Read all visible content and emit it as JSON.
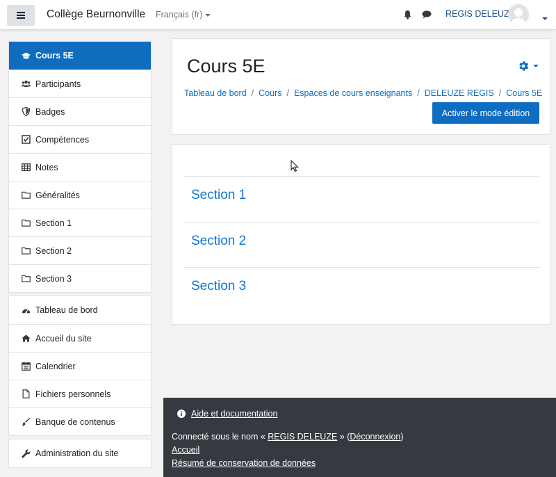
{
  "navbar": {
    "site_name": "Collège Beurnonville",
    "language": "Français (fr)",
    "user_name": "REGIS DELEUZE"
  },
  "drawer": {
    "course_items": [
      {
        "label": "Cours 5E",
        "icon": "graduation-cap-icon",
        "active": true
      },
      {
        "label": "Participants",
        "icon": "users-icon"
      },
      {
        "label": "Badges",
        "icon": "shield-icon"
      },
      {
        "label": "Compétences",
        "icon": "checkbox-icon"
      },
      {
        "label": "Notes",
        "icon": "table-icon"
      },
      {
        "label": "Généralités",
        "icon": "folder-icon"
      },
      {
        "label": "Section 1",
        "icon": "folder-icon"
      },
      {
        "label": "Section 2",
        "icon": "folder-icon"
      },
      {
        "label": "Section 3",
        "icon": "folder-icon"
      }
    ],
    "site_items": [
      {
        "label": "Tableau de bord",
        "icon": "dashboard-icon"
      },
      {
        "label": "Accueil du site",
        "icon": "home-icon"
      },
      {
        "label": "Calendrier",
        "icon": "calendar-icon"
      },
      {
        "label": "Fichiers personnels",
        "icon": "file-icon"
      },
      {
        "label": "Banque de contenus",
        "icon": "paint-brush-icon"
      }
    ],
    "admin_items": [
      {
        "label": "Administration du site",
        "icon": "wrench-icon"
      }
    ]
  },
  "header": {
    "title": "Cours 5E",
    "breadcrumb": [
      "Tableau de bord",
      "Cours",
      "Espaces de cours enseignants",
      "DELEUZE REGIS",
      "Cours 5E"
    ],
    "separator": "/",
    "edit_button": "Activer le mode édition"
  },
  "content": {
    "sections": [
      "Section 1",
      "Section 2",
      "Section 3"
    ]
  },
  "footer": {
    "help_link": "Aide et documentation",
    "login_prefix": "Connecté sous le nom « ",
    "login_user": "REGIS DELEUZE",
    "login_middle": " » (",
    "logout_link": "Déconnexion",
    "login_suffix": ")",
    "home_link": "Accueil",
    "data_retention_link": "Résumé de conservation de données"
  },
  "colors": {
    "primary": "#0f6cbf",
    "footer_bg": "#343a40",
    "section_link": "#1177d1"
  }
}
